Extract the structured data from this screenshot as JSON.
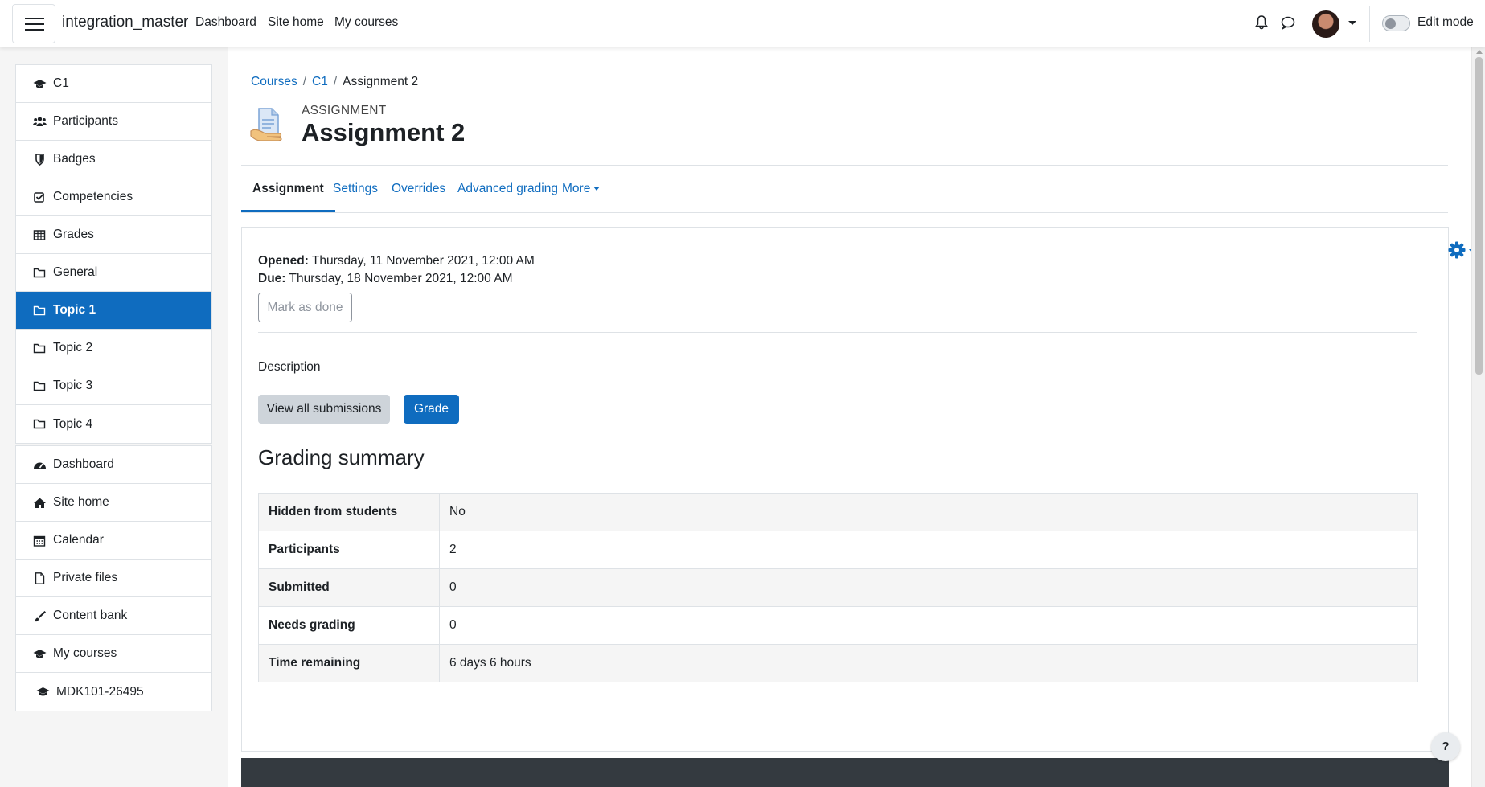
{
  "navbar": {
    "site_name": "integration_master",
    "links": [
      "Dashboard",
      "Site home",
      "My courses"
    ],
    "edit_mode_label": "Edit mode"
  },
  "sidebar": {
    "course_items": [
      {
        "label": "C1",
        "icon": "graduation-cap-icon"
      },
      {
        "label": "Participants",
        "icon": "users-icon"
      },
      {
        "label": "Badges",
        "icon": "shield-icon"
      },
      {
        "label": "Competencies",
        "icon": "check-square-icon"
      },
      {
        "label": "Grades",
        "icon": "table-icon"
      },
      {
        "label": "General",
        "icon": "folder-icon"
      },
      {
        "label": "Topic 1",
        "icon": "folder-icon",
        "active": true
      },
      {
        "label": "Topic 2",
        "icon": "folder-icon"
      },
      {
        "label": "Topic 3",
        "icon": "folder-icon"
      },
      {
        "label": "Topic 4",
        "icon": "folder-icon"
      }
    ],
    "site_items": [
      {
        "label": "Dashboard",
        "icon": "tachometer-icon"
      },
      {
        "label": "Site home",
        "icon": "home-icon"
      },
      {
        "label": "Calendar",
        "icon": "calendar-icon"
      },
      {
        "label": "Private files",
        "icon": "file-icon"
      },
      {
        "label": "Content bank",
        "icon": "paint-brush-icon"
      },
      {
        "label": "My courses",
        "icon": "graduation-cap-icon"
      },
      {
        "label": "MDK101-26495",
        "icon": "graduation-cap-icon"
      }
    ]
  },
  "breadcrumb": {
    "items": [
      "Courses",
      "C1"
    ],
    "current": "Assignment 2"
  },
  "header": {
    "pre_title": "ASSIGNMENT",
    "title": "Assignment 2"
  },
  "tabs": [
    "Assignment",
    "Settings",
    "Overrides",
    "Advanced grading",
    "More"
  ],
  "dates": {
    "opened_label": "Opened:",
    "opened_value": "Thursday, 11 November 2021, 12:00 AM",
    "due_label": "Due:",
    "due_value": "Thursday, 18 November 2021, 12:00 AM"
  },
  "buttons": {
    "mark_done": "Mark as done",
    "view_all": "View all submissions",
    "grade": "Grade"
  },
  "description_label": "Description",
  "grading_summary": {
    "title": "Grading summary",
    "rows": [
      {
        "label": "Hidden from students",
        "value": "No"
      },
      {
        "label": "Participants",
        "value": "2"
      },
      {
        "label": "Submitted",
        "value": "0"
      },
      {
        "label": "Needs grading",
        "value": "0"
      },
      {
        "label": "Time remaining",
        "value": "6 days 6 hours"
      }
    ]
  },
  "help_label": "?",
  "colors": {
    "primary": "#0f6cbf",
    "text": "#1d2125",
    "footer": "#343a40"
  }
}
